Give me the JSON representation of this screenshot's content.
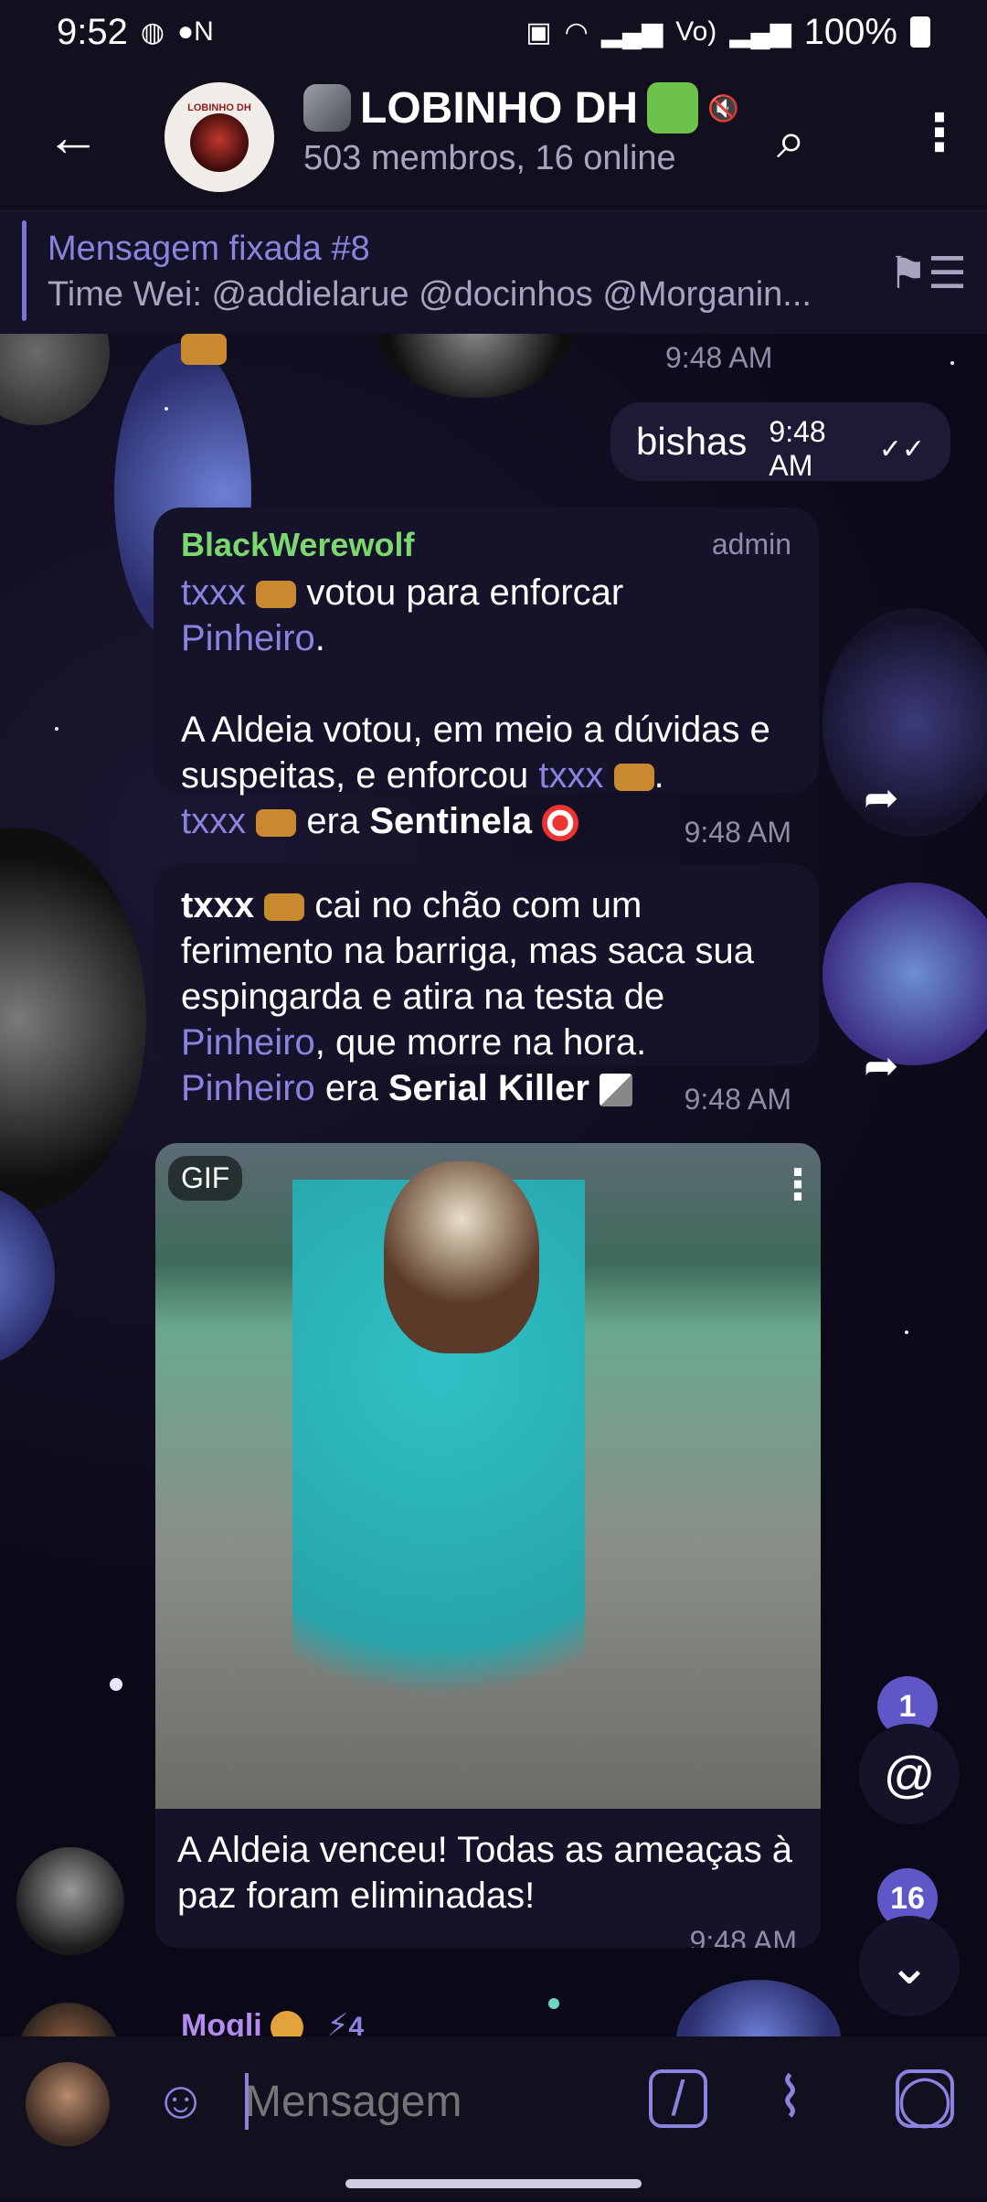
{
  "status": {
    "time": "9:52",
    "battery": "100%"
  },
  "header": {
    "title": "LOBINHO DH",
    "subtitle": "503 membros, 16 online",
    "avatar_text": "LOBINHO DH"
  },
  "pinned": {
    "title": "Mensagem fixada #8",
    "text": "Time Wei: @addielarue   @docinhos  @Morganin..."
  },
  "messages": [
    {
      "id": "partial-top",
      "time": "9:48 AM"
    },
    {
      "id": "out-bishas",
      "text": "bishas",
      "time": "9:48 AM"
    },
    {
      "id": "vote",
      "sender": "BlackWerewolf",
      "role": "admin",
      "line1_link": "txxx",
      "line1_rest": " votou para enforcar",
      "line2_link": "Pinheiro",
      "line2_rest": ".",
      "para2": "A Aldeia votou, em meio a dúvidas e suspeitas, e enforcou ",
      "para2_link": "txxx",
      "para2_end": ".",
      "line3_link": "txxx",
      "line3_mid": " era ",
      "line3_bold": "Sentinela",
      "time": "9:48 AM"
    },
    {
      "id": "shot",
      "bold_start": "txxx",
      "text1": " cai no chão com um ferimento na barriga, mas saca sua espingarda e atira na testa de ",
      "link1": "Pinheiro",
      "text2": ", que morre na hora.",
      "link2": "Pinheiro",
      "text3": " era ",
      "bold_end": "Serial Killer",
      "time": "9:48 AM"
    },
    {
      "id": "gif",
      "badge": "GIF",
      "caption": "A Aldeia venceu! Todas as ameaças à paz foram eliminadas!",
      "time": "9:48 AM"
    },
    {
      "id": "next",
      "sender": "Mogli",
      "boost": "4"
    }
  ],
  "badges": {
    "mentions": "1",
    "unread": "16"
  },
  "composer": {
    "placeholder": "Mensagem"
  },
  "colors": {
    "accent": "#8a83e0",
    "sender_green": "#7bd86e",
    "background": "#0d0b1a"
  }
}
